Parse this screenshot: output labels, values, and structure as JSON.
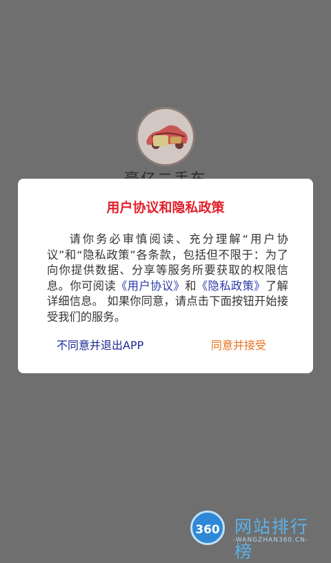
{
  "splash": {
    "title": "豪亿二手车"
  },
  "dialog": {
    "title": "用户协议和隐私政策",
    "body_part1": "请你务必审慎阅读、充分理解“用户协议”和“隐私政策”各条款，包括但不限于：为了向你提供数据、分享等服务所要获取的权限信息。你可阅读",
    "link_user_agreement": "《用户协议》",
    "body_and": "和",
    "link_privacy_policy": "《隐私政策》",
    "body_part2": "了解详细信息。  如果你同意，请点击下面按钮开始接受我们的服务。",
    "disagree_label": "不同意并退出APP",
    "agree_label": "同意并接受"
  },
  "watermark": {
    "badge": "360",
    "text": "网站排行榜",
    "url": "-WANGZHAN360.CN-"
  },
  "colors": {
    "title_red": "#e2202a",
    "link_blue": "#2b3aa6",
    "disagree_blue": "#1a2896",
    "agree_orange": "#e8701a",
    "overlay": "#6f6f6f"
  }
}
